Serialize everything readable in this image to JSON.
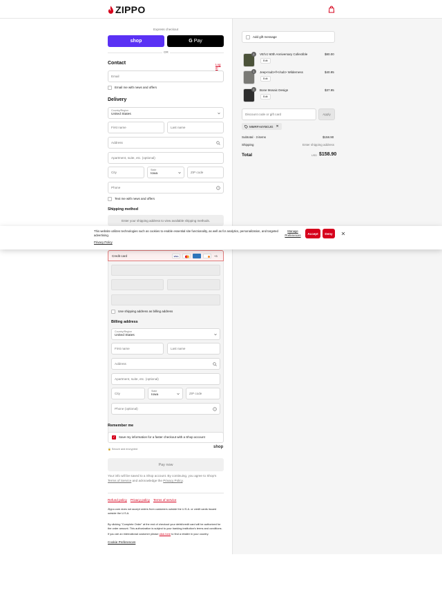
{
  "header": {
    "brand": "ZIPPO",
    "cart_icon": "shopping-bag-icon"
  },
  "express": {
    "title": "Express checkout",
    "shop_label": "shop",
    "gpay_label": "Pay",
    "or": "OR"
  },
  "contact": {
    "title": "Contact",
    "login": "Log in",
    "email_placeholder": "Email",
    "news_label": "Email me with news and offers"
  },
  "delivery": {
    "title": "Delivery",
    "country_label": "Country/Region",
    "country_value": "United States",
    "first_name": "First name",
    "last_name": "Last name",
    "address": "Address",
    "apartment": "Apartment, suite, etc. (optional)",
    "city": "City",
    "state_label": "State",
    "state_value": "Iowa",
    "zip": "ZIP code",
    "phone": "Phone",
    "text_news": "Text me with news and offers"
  },
  "shipping": {
    "title": "Shipping method",
    "placeholder": "Enter your shipping address to view available shipping methods."
  },
  "cookie": {
    "text": "This website utilizes technologies such as cookies to enable essential site functionality, as well as for analytics, personalization, and targeted advertising.",
    "privacy": "Privacy Policy",
    "manage": "Manage Preferences",
    "accept": "Accept",
    "deny": "Deny"
  },
  "payment": {
    "credit_card": "Credit card",
    "more_cards": "+3",
    "cards": [
      "VISA",
      "MC",
      "AMEX",
      "DISCOVER"
    ],
    "use_shipping": "Use shipping address as billing address"
  },
  "billing": {
    "title": "Billing address",
    "country_label": "Country/Region",
    "country_value": "United States",
    "first_name": "First name",
    "last_name": "Last name",
    "address": "Address",
    "apartment": "Apartment, suite, etc. (optional)",
    "city": "City",
    "state_label": "State",
    "state_value": "Iowa",
    "zip": "ZIP code",
    "phone": "Phone (optional)"
  },
  "remember": {
    "title": "Remember me",
    "save_label": "Save my information for a faster checkout with a Shop account",
    "secure": "Secure and encrypted",
    "shop_logo": "shop"
  },
  "pay": {
    "label": "Pay now",
    "disclaimer_a": "Your info will be saved to a Shop account. By continuing, you agree to Shop's",
    "terms": "Terms of Service",
    "disclaimer_b": "and acknowledge the",
    "privacy": "Privacy Policy",
    "period": "."
  },
  "footer": {
    "links": [
      "Refund policy",
      "Privacy policy",
      "Terms of service"
    ],
    "note1": "Zippo.com does not accept orders from customers outside the U.S.A. or credit cards issued outside the U.S.A.",
    "note2": "By clicking \"Complete Order\" at the end of checkout your debit/credit card will be authorized for the order amount. This authorization is subject to your banking institution's terms and conditions.",
    "note3_a": "If you are an international customer please",
    "note3_link": "click here",
    "note3_b": "to find a retailer in your country.",
    "cookie_prefs": "Cookie Preferences"
  },
  "summary": {
    "gift": "Add gift message",
    "items": [
      {
        "qty": "1",
        "name": "VE/VJ 60th Anniversary Collectible",
        "price": "$80.00",
        "edit": "Edit"
      },
      {
        "qty": "1",
        "name": "Jeep<sub>®</sub> Wilderness",
        "price": "$40.95",
        "edit": "Edit"
      },
      {
        "qty": "1",
        "name": "Bone Mosaic Design",
        "price": "$37.95",
        "edit": "Edit"
      }
    ],
    "discount_placeholder": "Discount code or gift card",
    "apply": "Apply",
    "code": "MMRFH4YBGJG",
    "subtotal_label": "Subtotal · 3 items",
    "subtotal": "$158.90",
    "shipping_label": "Shipping",
    "shipping_value": "Enter shipping address",
    "total_label": "Total",
    "currency": "USD",
    "total": "$158.90"
  },
  "colors": {
    "brand_red": "#d6001c",
    "shop_purple": "#5a31f4"
  }
}
